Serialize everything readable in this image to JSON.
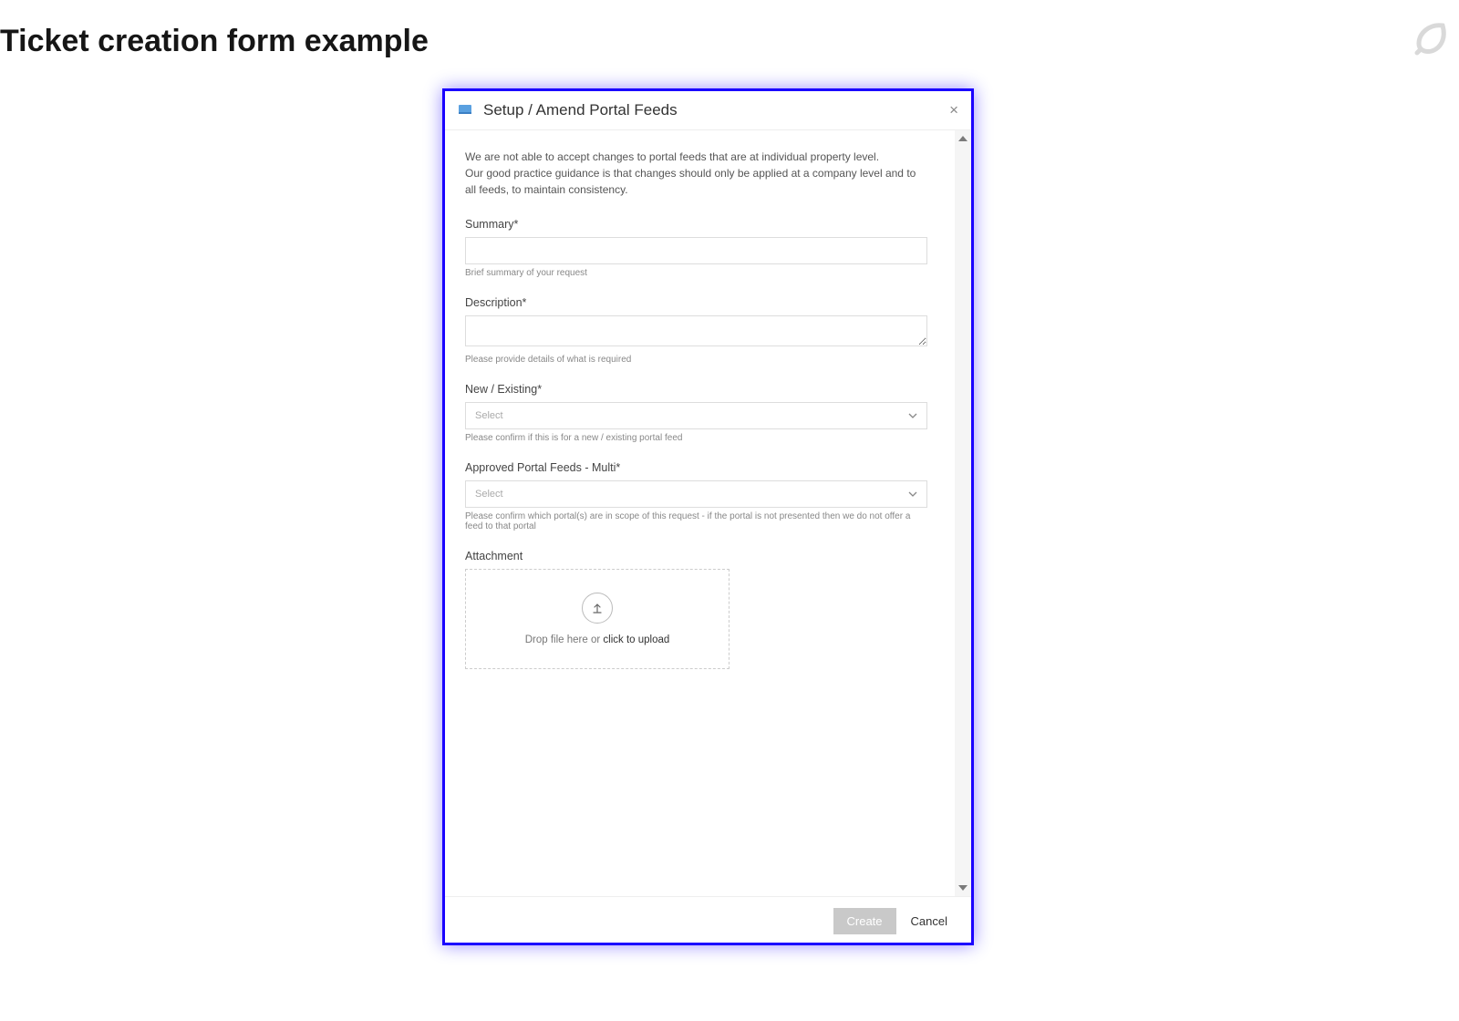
{
  "page": {
    "title": "Ticket creation form example"
  },
  "modal": {
    "title": "Setup / Amend Portal Feeds",
    "intro_line1": "We are not able to accept changes to portal feeds that are at individual property level.",
    "intro_line2": "Our good practice guidance is that changes should only be applied at a company level and to all feeds, to maintain consistency.",
    "fields": {
      "summary": {
        "label": "Summary*",
        "hint": "Brief summary of your request"
      },
      "description": {
        "label": "Description*",
        "hint": "Please provide details of what is required"
      },
      "new_existing": {
        "label": "New / Existing*",
        "placeholder": "Select",
        "hint": "Please confirm if this is for a new / existing portal feed"
      },
      "approved_feeds": {
        "label": "Approved Portal Feeds - Multi*",
        "placeholder": "Select",
        "hint": "Please confirm which portal(s) are in scope of this request - if the portal is not presented then we do not offer a feed to that portal"
      },
      "attachment": {
        "label": "Attachment",
        "drop_text_prefix": "Drop file here or ",
        "drop_text_action": "click to upload"
      }
    },
    "footer": {
      "create": "Create",
      "cancel": "Cancel"
    }
  }
}
